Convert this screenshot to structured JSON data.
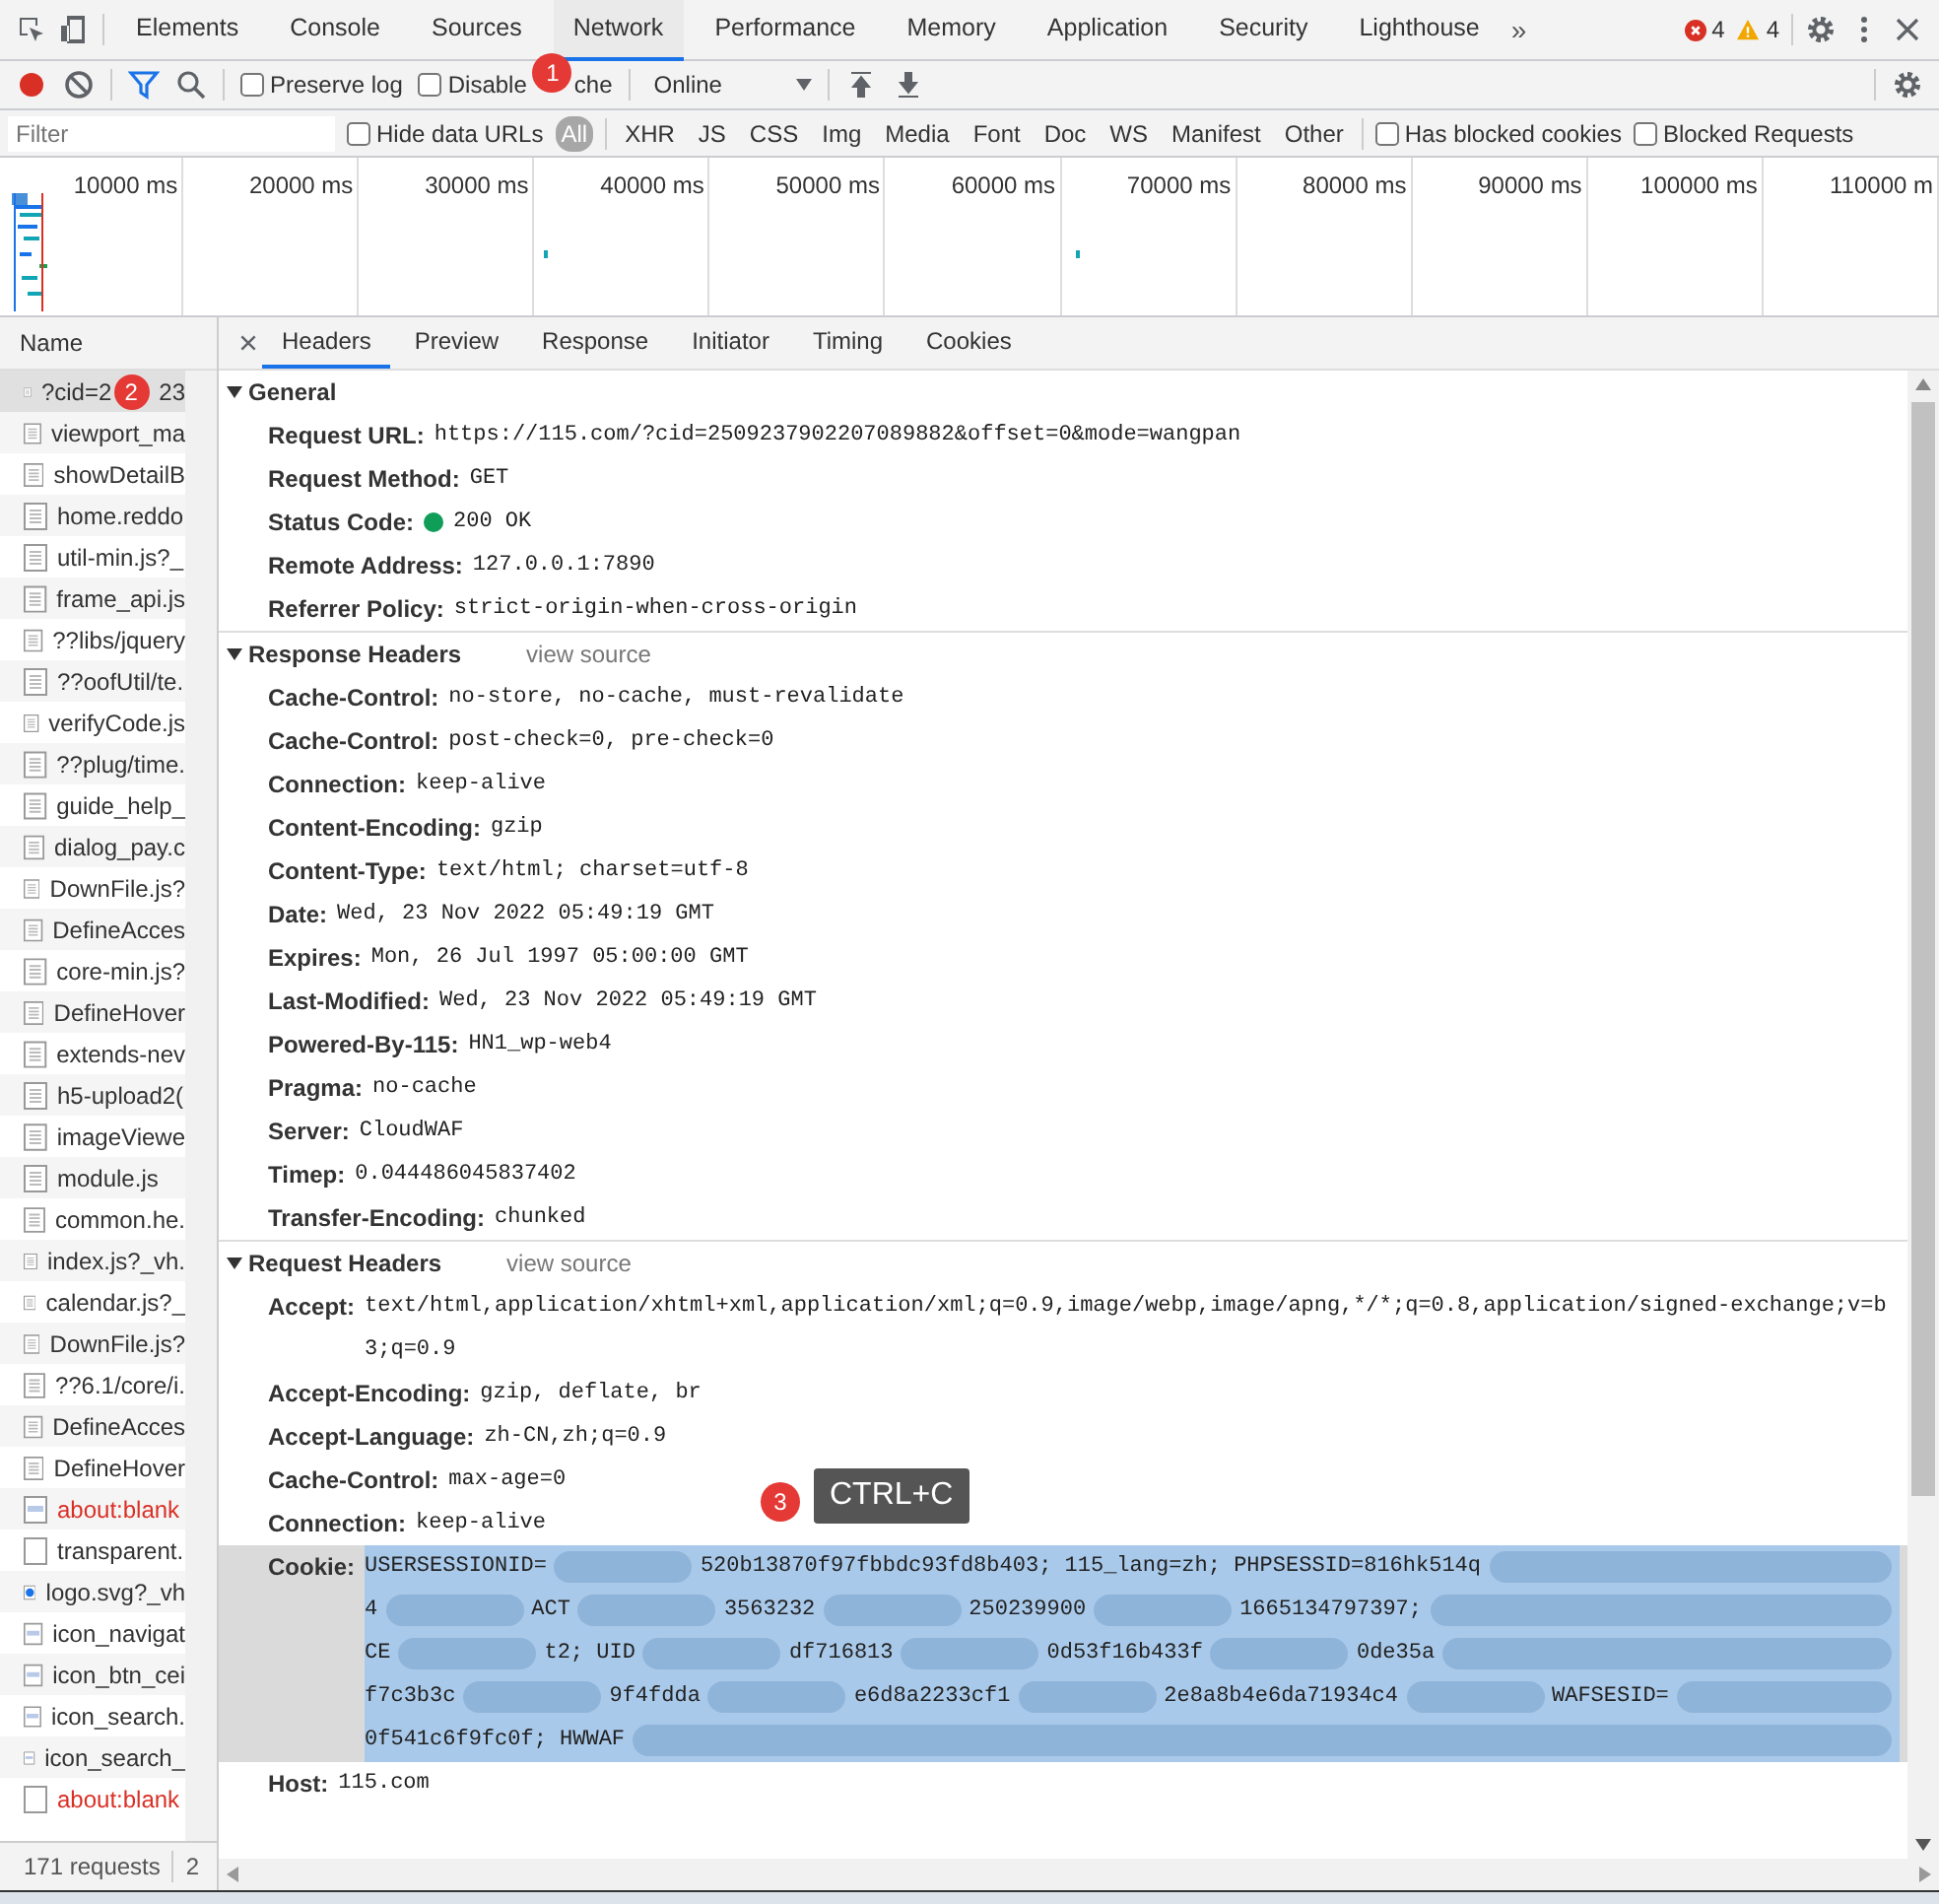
{
  "main_tabs": [
    {
      "label": "Elements",
      "selected": false
    },
    {
      "label": "Console",
      "selected": false
    },
    {
      "label": "Sources",
      "selected": false
    },
    {
      "label": "Network",
      "selected": true
    },
    {
      "label": "Performance",
      "selected": false
    },
    {
      "label": "Memory",
      "selected": false
    },
    {
      "label": "Application",
      "selected": false
    },
    {
      "label": "Security",
      "selected": false
    },
    {
      "label": "Lighthouse",
      "selected": false
    }
  ],
  "more_tabs": "»",
  "issues": {
    "errors": "4",
    "warnings": "4"
  },
  "toolbar": {
    "recording": true,
    "preserve_log": {
      "label": "Preserve log",
      "checked": false
    },
    "disable_cache": {
      "label": "Disable",
      "label_after_badge": "che",
      "checked": false
    },
    "throttling": "Online"
  },
  "filter_bar": {
    "placeholder": "Filter",
    "hide_data_urls": {
      "label": "Hide data URLs",
      "checked": false
    },
    "types": [
      {
        "label": "All",
        "selected": true
      },
      {
        "label": "XHR",
        "selected": false
      },
      {
        "label": "JS",
        "selected": false
      },
      {
        "label": "CSS",
        "selected": false
      },
      {
        "label": "Img",
        "selected": false
      },
      {
        "label": "Media",
        "selected": false
      },
      {
        "label": "Font",
        "selected": false
      },
      {
        "label": "Doc",
        "selected": false
      },
      {
        "label": "WS",
        "selected": false
      },
      {
        "label": "Manifest",
        "selected": false
      },
      {
        "label": "Other",
        "selected": false
      }
    ],
    "has_blocked_cookies": {
      "label": "Has blocked cookies",
      "checked": false
    },
    "blocked_requests": {
      "label": "Blocked Requests",
      "checked": false
    }
  },
  "timeline": {
    "ticks": [
      "10000 ms",
      "20000 ms",
      "30000 ms",
      "40000 ms",
      "50000 ms",
      "60000 ms",
      "70000 ms",
      "80000 ms",
      "90000 ms",
      "100000 ms",
      "110000 m"
    ]
  },
  "requests": {
    "header": "Name",
    "items": [
      {
        "name": "?cid=2",
        "name_after_badge": "23",
        "kind": "doc",
        "error": false,
        "selected": true
      },
      {
        "name": "viewport_ma",
        "kind": "doc",
        "error": false,
        "selected": false
      },
      {
        "name": "showDetailB",
        "kind": "doc",
        "error": false,
        "selected": false
      },
      {
        "name": "home.reddo",
        "kind": "doc",
        "error": false,
        "selected": false
      },
      {
        "name": "util-min.js?_",
        "kind": "doc",
        "error": false,
        "selected": false
      },
      {
        "name": "frame_api.js",
        "kind": "doc",
        "error": false,
        "selected": false
      },
      {
        "name": "??libs/jquery",
        "kind": "doc",
        "error": false,
        "selected": false
      },
      {
        "name": "??oofUtil/te.",
        "kind": "doc",
        "error": false,
        "selected": false
      },
      {
        "name": "verifyCode.js",
        "kind": "doc",
        "error": false,
        "selected": false
      },
      {
        "name": "??plug/time.",
        "kind": "doc",
        "error": false,
        "selected": false
      },
      {
        "name": "guide_help_",
        "kind": "doc",
        "error": false,
        "selected": false
      },
      {
        "name": "dialog_pay.c",
        "kind": "doc",
        "error": false,
        "selected": false
      },
      {
        "name": "DownFile.js?",
        "kind": "doc",
        "error": false,
        "selected": false
      },
      {
        "name": "DefineAcces",
        "kind": "doc",
        "error": false,
        "selected": false
      },
      {
        "name": "core-min.js?",
        "kind": "doc",
        "error": false,
        "selected": false
      },
      {
        "name": "DefineHover",
        "kind": "doc",
        "error": false,
        "selected": false
      },
      {
        "name": "extends-nev",
        "kind": "doc",
        "error": false,
        "selected": false
      },
      {
        "name": "h5-upload2(",
        "kind": "doc",
        "error": false,
        "selected": false
      },
      {
        "name": "imageViewe",
        "kind": "doc",
        "error": false,
        "selected": false
      },
      {
        "name": "module.js",
        "kind": "doc",
        "error": false,
        "selected": false
      },
      {
        "name": "common.he.",
        "kind": "doc",
        "error": false,
        "selected": false
      },
      {
        "name": "index.js?_vh.",
        "kind": "doc",
        "error": false,
        "selected": false
      },
      {
        "name": "calendar.js?_",
        "kind": "doc",
        "error": false,
        "selected": false
      },
      {
        "name": "DownFile.js?",
        "kind": "doc",
        "error": false,
        "selected": false
      },
      {
        "name": "??6.1/core/i.",
        "kind": "doc",
        "error": false,
        "selected": false
      },
      {
        "name": "DefineAcces",
        "kind": "doc",
        "error": false,
        "selected": false
      },
      {
        "name": "DefineHover",
        "kind": "doc",
        "error": false,
        "selected": false
      },
      {
        "name": "about:blank",
        "kind": "image",
        "error": true,
        "selected": false
      },
      {
        "name": "transparent.",
        "kind": "blank",
        "error": false,
        "selected": false
      },
      {
        "name": "logo.svg?_vh",
        "kind": "svg",
        "error": false,
        "selected": false
      },
      {
        "name": "icon_navigat",
        "kind": "image",
        "error": false,
        "selected": false
      },
      {
        "name": "icon_btn_cei",
        "kind": "image",
        "error": false,
        "selected": false
      },
      {
        "name": "icon_search.",
        "kind": "image",
        "error": false,
        "selected": false
      },
      {
        "name": "icon_search_",
        "kind": "image",
        "error": false,
        "selected": false
      },
      {
        "name": "about:blank",
        "kind": "blank",
        "error": true,
        "selected": false
      }
    ]
  },
  "status_bar": {
    "requests": "171 requests",
    "transferred": "2"
  },
  "detail_tabs": [
    {
      "label": "Headers",
      "selected": true
    },
    {
      "label": "Preview",
      "selected": false
    },
    {
      "label": "Response",
      "selected": false
    },
    {
      "label": "Initiator",
      "selected": false
    },
    {
      "label": "Timing",
      "selected": false
    },
    {
      "label": "Cookies",
      "selected": false
    }
  ],
  "sections": [
    {
      "title": "General",
      "expanded": true,
      "rows": [
        {
          "key": "Request URL:",
          "value": "https://115.com/?cid=2509237902207089882&offset=0&mode=wangpan"
        },
        {
          "key": "Request Method:",
          "value": "GET"
        },
        {
          "key": "Status Code:",
          "value": "200 OK",
          "status_dot": true
        },
        {
          "key": "Remote Address:",
          "value": "127.0.0.1:7890"
        },
        {
          "key": "Referrer Policy:",
          "value": "strict-origin-when-cross-origin"
        }
      ]
    },
    {
      "title": "Response Headers",
      "expanded": true,
      "view_source": "view source",
      "rows": [
        {
          "key": "Cache-Control:",
          "value": "no-store, no-cache, must-revalidate"
        },
        {
          "key": "Cache-Control:",
          "value": "post-check=0, pre-check=0"
        },
        {
          "key": "Connection:",
          "value": "keep-alive"
        },
        {
          "key": "Content-Encoding:",
          "value": "gzip"
        },
        {
          "key": "Content-Type:",
          "value": "text/html; charset=utf-8"
        },
        {
          "key": "Date:",
          "value": "Wed, 23 Nov 2022 05:49:19 GMT"
        },
        {
          "key": "Expires:",
          "value": "Mon, 26 Jul 1997 05:00:00 GMT"
        },
        {
          "key": "Last-Modified:",
          "value": "Wed, 23 Nov 2022 05:49:19 GMT"
        },
        {
          "key": "Powered-By-115:",
          "value": "HN1_wp-web4"
        },
        {
          "key": "Pragma:",
          "value": "no-cache"
        },
        {
          "key": "Server:",
          "value": "CloudWAF"
        },
        {
          "key": "Timep:",
          "value": "0.044486045837402"
        },
        {
          "key": "Transfer-Encoding:",
          "value": "chunked"
        }
      ]
    },
    {
      "title": "Request Headers",
      "expanded": true,
      "view_source": "view source",
      "rows": [
        {
          "key": "Accept:",
          "value": "text/html,application/xhtml+xml,application/xml;q=0.9,image/webp,image/apng,*/*;q=0.8,application/signed-exchange;v=b3;q=0.9"
        },
        {
          "key": "Accept-Encoding:",
          "value": "gzip, deflate, br"
        },
        {
          "key": "Accept-Language:",
          "value": "zh-CN,zh;q=0.9"
        },
        {
          "key": "Cache-Control:",
          "value": "max-age=0"
        },
        {
          "key": "Connection:",
          "value": "keep-alive"
        },
        {
          "key": "Cookie:",
          "selected": true,
          "redacted_lines": [
            [
              "USERSESSIONID=",
              "520b13870f97fbbdc93fd8b403; 115_lang=zh; PHPSESSID=816hk514q"
            ],
            [
              "4",
              "ACT",
              "3563232",
              "250239900",
              "1665134797397;"
            ],
            [
              "CE",
              "t2; UID",
              "df716813",
              "0d53f16b433f",
              "0de35a"
            ],
            [
              "f7c3b3c",
              "9f4fdda",
              "e6d8a2233cf1",
              "2e8a8b4e6da71934c4",
              "WAFSESID="
            ],
            [
              "0f541c6f9fc0f; HWWAF"
            ]
          ]
        },
        {
          "key": "Host:",
          "value": "115.com"
        }
      ]
    }
  ],
  "annotations": [
    {
      "label": "1"
    },
    {
      "label": "2"
    },
    {
      "label": "3",
      "tooltip": "CTRL+C"
    }
  ]
}
